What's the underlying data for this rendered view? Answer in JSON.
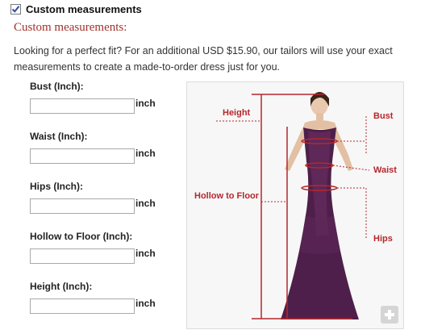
{
  "header": {
    "checkbox_label": "Custom measurements",
    "checked": true
  },
  "section": {
    "title": "Custom measurements:",
    "description": "Looking for a perfect fit? For an additional USD  $15.90, our tailors will use your exact measurements to create a made-to-order dress just for you."
  },
  "fields": [
    {
      "label": "Bust (Inch):",
      "value": "",
      "unit": "inch"
    },
    {
      "label": "Waist (Inch):",
      "value": "",
      "unit": "inch"
    },
    {
      "label": "Hips (Inch):",
      "value": "",
      "unit": "inch"
    },
    {
      "label": "Hollow to Floor (Inch):",
      "value": "",
      "unit": "inch"
    },
    {
      "label": "Height (Inch):",
      "value": "",
      "unit": "inch"
    }
  ],
  "diagram": {
    "labels": {
      "height": "Height",
      "bust": "Bust",
      "waist": "Waist",
      "hollow": "Hollow to Floor",
      "hips": "Hips"
    },
    "accent_color": "#b5272d",
    "dress_color": "#4e1f4a"
  },
  "icons": {
    "checkbox": "checkmark-icon",
    "zoom": "plus-icon"
  }
}
